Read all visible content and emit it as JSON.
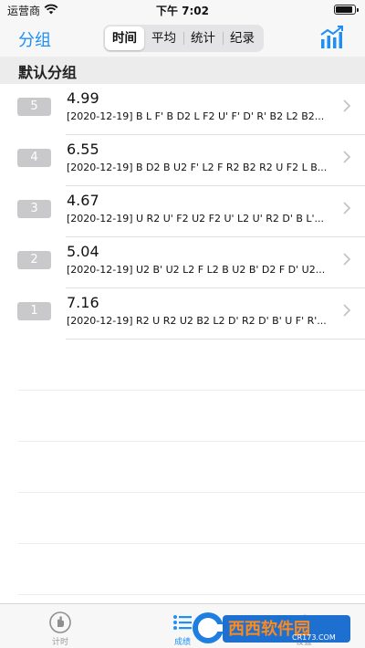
{
  "status": {
    "carrier": "运营商",
    "time": "下午 7:02"
  },
  "nav": {
    "left_label": "分组",
    "tabs": [
      "时间",
      "平均",
      "统计",
      "纪录"
    ],
    "active_tab": 0
  },
  "section": {
    "title": "默认分组"
  },
  "rows": [
    {
      "index": "5",
      "time": "4.99",
      "scramble": "[2020-12-19] B L F' B D2 L F2 U' F' D' R' B2 L2 B2..."
    },
    {
      "index": "4",
      "time": "6.55",
      "scramble": "[2020-12-19] B D2 B U2 F' L2 F R2 B2 R2 U F2 L B..."
    },
    {
      "index": "3",
      "time": "4.67",
      "scramble": "[2020-12-19] U R2 U' F2 U2 F2 U' L2 U' R2 D' B L'..."
    },
    {
      "index": "2",
      "time": "5.04",
      "scramble": "[2020-12-19] U2 B' U2 L2 F L2 B U2 B' D2 F D' U2..."
    },
    {
      "index": "1",
      "time": "7.16",
      "scramble": "[2020-12-19] R2 U R2 U2 B2 L2 D' R2 D' B' U F' R'..."
    }
  ],
  "tabbar": {
    "items": [
      {
        "label": "计时",
        "icon": "hand-icon"
      },
      {
        "label": "成绩",
        "icon": "list-icon"
      },
      {
        "label": "设置",
        "icon": "gear-icon"
      }
    ],
    "active": 1
  },
  "watermark": {
    "brand": "西西软件园",
    "site": "CR173.COM"
  },
  "colors": {
    "accent": "#1f8ff5",
    "badge": "#c9c9cc",
    "header_bg": "#ececec"
  }
}
